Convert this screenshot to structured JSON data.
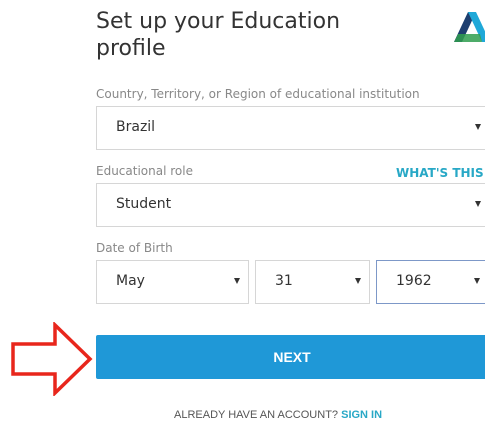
{
  "header": {
    "title": "Set up your Education profile",
    "logo_icon": "autodesk-logo-icon"
  },
  "form": {
    "country": {
      "label": "Country, Territory, or Region of educational institution",
      "value": "Brazil"
    },
    "role": {
      "label": "Educational role",
      "value": "Student",
      "help_link": "WHAT'S THIS ?"
    },
    "dob": {
      "label": "Date of Birth",
      "month": "May",
      "day": "31",
      "year": "1962"
    },
    "next_label": "NEXT"
  },
  "footer": {
    "prompt": "ALREADY HAVE AN ACCOUNT?",
    "signin_label": "SIGN IN"
  },
  "colors": {
    "primary": "#1f98d7",
    "link": "#28a8c6",
    "annotation_arrow": "#e8261c"
  }
}
